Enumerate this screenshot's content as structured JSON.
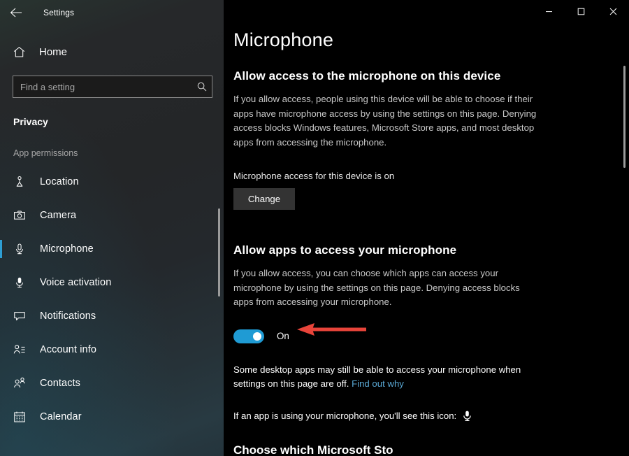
{
  "window": {
    "title": "Settings",
    "back_icon": "back-arrow-icon",
    "minimize_label": "—",
    "maximize_label": "□",
    "close_label": "✕"
  },
  "sidebar": {
    "home_label": "Home",
    "home_icon": "home-icon",
    "search": {
      "placeholder": "Find a setting",
      "value": "",
      "icon": "search-icon"
    },
    "section_title": "Privacy",
    "group_title": "App permissions",
    "items": [
      {
        "label": "Location",
        "icon": "location-icon",
        "selected": false
      },
      {
        "label": "Camera",
        "icon": "camera-icon",
        "selected": false
      },
      {
        "label": "Microphone",
        "icon": "microphone-icon",
        "selected": true
      },
      {
        "label": "Voice activation",
        "icon": "voice-icon",
        "selected": false
      },
      {
        "label": "Notifications",
        "icon": "notification-icon",
        "selected": false
      },
      {
        "label": "Account info",
        "icon": "account-info-icon",
        "selected": false
      },
      {
        "label": "Contacts",
        "icon": "contacts-icon",
        "selected": false
      },
      {
        "label": "Calendar",
        "icon": "calendar-icon",
        "selected": false
      }
    ]
  },
  "main": {
    "page_title": "Microphone",
    "device_section": {
      "heading": "Allow access to the microphone on this device",
      "body": "If you allow access, people using this device will be able to choose if their apps have microphone access by using the settings on this page. Denying access blocks Windows features, Microsoft Store apps, and most desktop apps from accessing the microphone.",
      "status": "Microphone access for this device is on",
      "change_button": "Change"
    },
    "apps_section": {
      "heading": "Allow apps to access your microphone",
      "body": "If you allow access, you can choose which apps can access your microphone by using the settings on this page. Denying access blocks apps from accessing your microphone.",
      "toggle_state": "On",
      "toggle_on": true,
      "note_text": "Some desktop apps may still be able to access your microphone when settings on this page are off. ",
      "note_link": "Find out why",
      "icon_line": "If an app is using your microphone, you'll see this icon:",
      "icon_name": "microphone-icon",
      "next_heading": "Choose which Microsoft Sto"
    }
  },
  "annotation": {
    "arrow_color": "#e8443a",
    "arrow_name": "red-pointer-arrow"
  },
  "colors": {
    "accent": "#2e9fd4",
    "toggle_on": "#1f9bd4",
    "link": "#5aa9d6",
    "background": "#000000"
  }
}
